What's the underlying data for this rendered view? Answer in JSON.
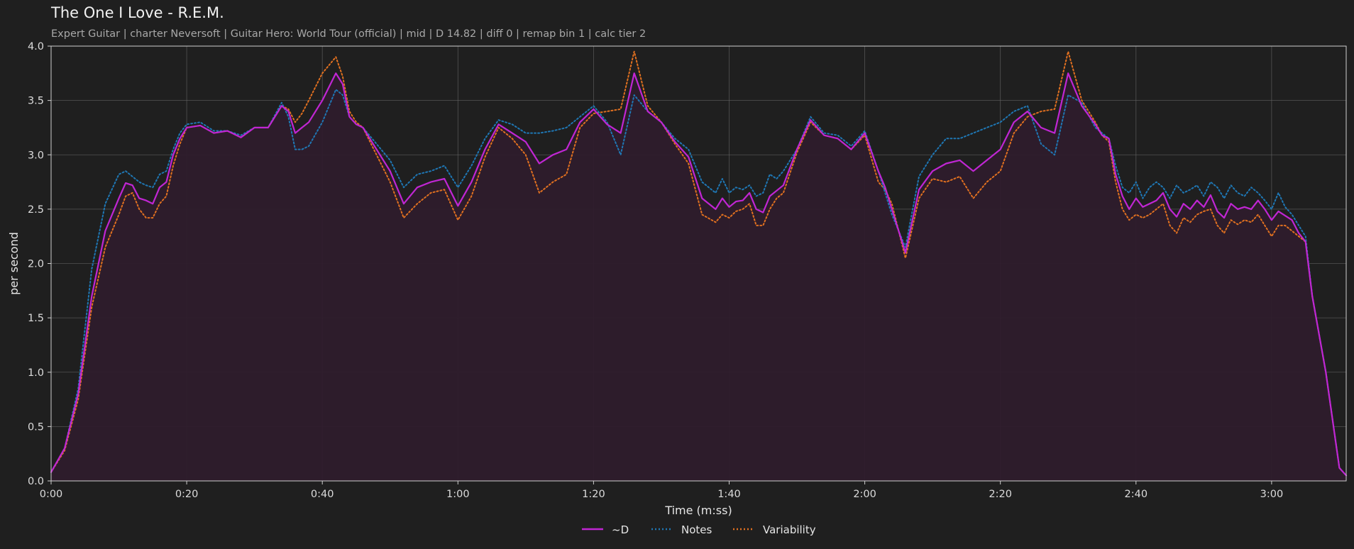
{
  "header": {
    "title": "The One I Love - R.E.M.",
    "subtitle": "Expert Guitar  |  charter Neversoft  |  Guitar Hero: World Tour (official)  |  mid  |  D 14.82  |  diff 0  |  remap bin 1  |  calc tier 2"
  },
  "colors": {
    "background": "#1f1f1f",
    "plot_background": "#1f1f1f",
    "d_line": "#c026d3",
    "d_fill": "#2e1c2c",
    "notes_line": "#1f77b4",
    "variability_line": "#e07020",
    "grid": "#6a6a6a",
    "axis": "#cfcfcf"
  },
  "chart_data": {
    "type": "line",
    "xlabel": "Time (m:ss)",
    "ylabel": "per second",
    "xlim": [
      0,
      191
    ],
    "ylim": [
      0,
      4.0
    ],
    "x_ticks": [
      0,
      20,
      40,
      60,
      80,
      100,
      120,
      140,
      160,
      180
    ],
    "x_tick_labels": [
      "0:00",
      "0:20",
      "0:40",
      "1:00",
      "1:20",
      "1:40",
      "2:00",
      "2:20",
      "2:40",
      "3:00"
    ],
    "y_ticks": [
      0.0,
      0.5,
      1.0,
      1.5,
      2.0,
      2.5,
      3.0,
      3.5,
      4.0
    ],
    "y_tick_labels": [
      "0.0",
      "0.5",
      "1.0",
      "1.5",
      "2.0",
      "2.5",
      "3.0",
      "3.5",
      "4.0"
    ],
    "grid": true,
    "legend_position": "bottom-center",
    "x": [
      0,
      2,
      4,
      6,
      8,
      10,
      11,
      12,
      13,
      14,
      15,
      16,
      17,
      18,
      19,
      20,
      22,
      24,
      26,
      28,
      30,
      32,
      34,
      35,
      36,
      37,
      38,
      40,
      42,
      43,
      44,
      45,
      46,
      48,
      50,
      52,
      54,
      56,
      58,
      60,
      62,
      64,
      66,
      68,
      70,
      72,
      74,
      76,
      78,
      80,
      82,
      84,
      86,
      88,
      90,
      92,
      94,
      96,
      98,
      99,
      100,
      101,
      102,
      103,
      104,
      105,
      106,
      107,
      108,
      110,
      112,
      114,
      116,
      118,
      120,
      122,
      123,
      124,
      126,
      128,
      130,
      132,
      134,
      136,
      138,
      140,
      142,
      144,
      146,
      148,
      150,
      152,
      154,
      155,
      156,
      157,
      158,
      159,
      160,
      161,
      162,
      163,
      164,
      165,
      166,
      167,
      168,
      169,
      170,
      171,
      172,
      173,
      174,
      175,
      176,
      177,
      178,
      179,
      180,
      181,
      182,
      183,
      184,
      185,
      186,
      188,
      190,
      191
    ],
    "series": [
      {
        "name": "~D",
        "style": "solid",
        "values": [
          0.08,
          0.3,
          0.8,
          1.7,
          2.3,
          2.6,
          2.74,
          2.72,
          2.6,
          2.58,
          2.55,
          2.7,
          2.75,
          3.0,
          3.15,
          3.25,
          3.27,
          3.2,
          3.22,
          3.16,
          3.25,
          3.25,
          3.45,
          3.4,
          3.2,
          3.25,
          3.3,
          3.5,
          3.75,
          3.65,
          3.35,
          3.28,
          3.25,
          3.05,
          2.85,
          2.55,
          2.7,
          2.75,
          2.78,
          2.53,
          2.75,
          3.05,
          3.28,
          3.2,
          3.12,
          2.92,
          3.0,
          3.05,
          3.3,
          3.42,
          3.28,
          3.2,
          3.75,
          3.4,
          3.3,
          3.12,
          2.98,
          2.6,
          2.5,
          2.6,
          2.52,
          2.57,
          2.58,
          2.65,
          2.5,
          2.47,
          2.62,
          2.67,
          2.72,
          3.05,
          3.32,
          3.18,
          3.15,
          3.05,
          3.2,
          2.85,
          2.7,
          2.5,
          2.1,
          2.68,
          2.85,
          2.92,
          2.95,
          2.85,
          2.95,
          3.05,
          3.3,
          3.4,
          3.25,
          3.2,
          3.75,
          3.45,
          3.28,
          3.18,
          3.15,
          2.82,
          2.62,
          2.5,
          2.6,
          2.52,
          2.55,
          2.58,
          2.65,
          2.5,
          2.43,
          2.55,
          2.5,
          2.58,
          2.52,
          2.63,
          2.48,
          2.42,
          2.55,
          2.5,
          2.52,
          2.5,
          2.58,
          2.5,
          2.4,
          2.48,
          2.44,
          2.4,
          2.28,
          2.2,
          1.7,
          1.0,
          0.12,
          0.05
        ]
      },
      {
        "name": "Notes",
        "style": "dotted",
        "values": [
          0.08,
          0.3,
          0.85,
          1.95,
          2.55,
          2.82,
          2.85,
          2.8,
          2.75,
          2.72,
          2.7,
          2.82,
          2.85,
          3.05,
          3.2,
          3.28,
          3.3,
          3.22,
          3.22,
          3.18,
          3.25,
          3.25,
          3.48,
          3.35,
          3.05,
          3.05,
          3.08,
          3.3,
          3.6,
          3.55,
          3.35,
          3.28,
          3.25,
          3.1,
          2.95,
          2.7,
          2.82,
          2.85,
          2.9,
          2.7,
          2.9,
          3.15,
          3.32,
          3.28,
          3.2,
          3.2,
          3.22,
          3.25,
          3.35,
          3.45,
          3.3,
          3.0,
          3.55,
          3.4,
          3.3,
          3.15,
          3.05,
          2.75,
          2.65,
          2.78,
          2.65,
          2.7,
          2.68,
          2.72,
          2.62,
          2.65,
          2.82,
          2.78,
          2.85,
          3.05,
          3.35,
          3.2,
          3.18,
          3.08,
          3.22,
          2.85,
          2.65,
          2.45,
          2.15,
          2.8,
          3.0,
          3.15,
          3.15,
          3.2,
          3.25,
          3.3,
          3.4,
          3.45,
          3.1,
          3.0,
          3.55,
          3.48,
          3.25,
          3.2,
          3.15,
          2.9,
          2.7,
          2.65,
          2.75,
          2.6,
          2.7,
          2.75,
          2.7,
          2.6,
          2.72,
          2.65,
          2.68,
          2.72,
          2.62,
          2.75,
          2.7,
          2.6,
          2.72,
          2.65,
          2.62,
          2.7,
          2.65,
          2.58,
          2.5,
          2.65,
          2.52,
          2.45,
          2.35,
          2.25,
          1.7,
          1.0,
          0.12,
          0.05
        ]
      },
      {
        "name": "Variability",
        "style": "dotted",
        "values": [
          0.08,
          0.28,
          0.75,
          1.6,
          2.15,
          2.45,
          2.62,
          2.65,
          2.5,
          2.42,
          2.42,
          2.55,
          2.62,
          2.9,
          3.1,
          3.25,
          3.27,
          3.2,
          3.22,
          3.16,
          3.25,
          3.25,
          3.45,
          3.42,
          3.3,
          3.38,
          3.5,
          3.75,
          3.9,
          3.72,
          3.4,
          3.3,
          3.25,
          3.0,
          2.75,
          2.42,
          2.55,
          2.65,
          2.68,
          2.4,
          2.62,
          2.98,
          3.25,
          3.15,
          3.0,
          2.65,
          2.75,
          2.82,
          3.25,
          3.38,
          3.4,
          3.42,
          3.95,
          3.45,
          3.3,
          3.1,
          2.92,
          2.45,
          2.38,
          2.45,
          2.42,
          2.48,
          2.5,
          2.55,
          2.35,
          2.35,
          2.5,
          2.6,
          2.65,
          3.02,
          3.3,
          3.18,
          3.15,
          3.05,
          3.18,
          2.75,
          2.68,
          2.55,
          2.05,
          2.6,
          2.78,
          2.75,
          2.8,
          2.6,
          2.75,
          2.85,
          3.2,
          3.35,
          3.4,
          3.42,
          3.95,
          3.5,
          3.3,
          3.18,
          3.12,
          2.75,
          2.5,
          2.4,
          2.45,
          2.42,
          2.45,
          2.5,
          2.55,
          2.35,
          2.28,
          2.42,
          2.38,
          2.45,
          2.48,
          2.5,
          2.35,
          2.28,
          2.4,
          2.36,
          2.4,
          2.38,
          2.45,
          2.35,
          2.25,
          2.35,
          2.35,
          2.3,
          2.25,
          2.2,
          1.7,
          1.0,
          0.12,
          0.05
        ]
      }
    ]
  }
}
